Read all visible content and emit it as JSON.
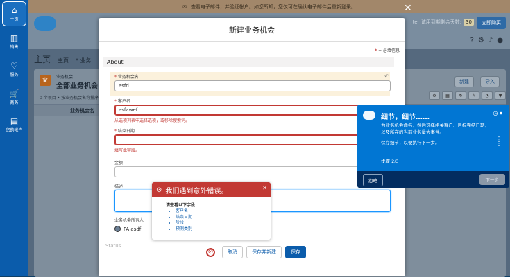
{
  "rail": [
    {
      "label": "主页",
      "icon": "⌂"
    },
    {
      "label": "销售",
      "icon": "▥"
    },
    {
      "label": "服务",
      "icon": "♡"
    },
    {
      "label": "商务",
      "icon": "🛒"
    },
    {
      "label": "您的帐户",
      "icon": "▤"
    }
  ],
  "banner": {
    "icon": "✉",
    "text": "查看电子邮件，并验证帐户。如您所知，您仅可在确认电子邮件后重新登录。"
  },
  "header": {
    "trial_text": "ter 试用到期剩余天数:",
    "trial_days": "30",
    "buy_label": "立即购买"
  },
  "nav": {
    "app_name": "主页",
    "tab1": "主页",
    "tab2": "* 业务…"
  },
  "list": {
    "sub": "业务机会",
    "title": "全部业务机会",
    "meta": "0 个项目 • 按业务机会名称排序 •",
    "new_label": "新建",
    "import_label": "导入",
    "column": "业务机会名"
  },
  "modal": {
    "title": "新建业务机会",
    "required_note": "= 必填信息",
    "section": "About",
    "name": {
      "label": "业务机会名",
      "value": "asfd"
    },
    "account": {
      "label": "客户名",
      "value": "asfawef",
      "error": "从选项列表中选择选项，或移除搜索词。"
    },
    "close_date": {
      "label": "结束日期",
      "value": "",
      "error": "填写此字段。"
    },
    "amount": {
      "label": "金额",
      "value": ""
    },
    "description": {
      "label": "描述",
      "value": ""
    },
    "owner": {
      "label": "业务机会所有人",
      "value": "FA asdf"
    },
    "status_label": "Status",
    "cancel": "取消",
    "save_new": "保存并新建",
    "save": "保存"
  },
  "error_popover": {
    "title": "我们遇到意外错误。",
    "subtitle": "请查看以下字段",
    "fields": [
      "客户名",
      "结束日期",
      "阶段",
      "预测类别"
    ]
  },
  "walkthrough": {
    "title": "细节，细节……",
    "text": "为业务机会命名，然后选择相关客户、目标完结日期，以及所在的当前业务量大事件。",
    "text2": "保存细节，以便执行下一步。",
    "step": "步骤 2/3",
    "ignore": "忽略",
    "next": "下一步"
  }
}
